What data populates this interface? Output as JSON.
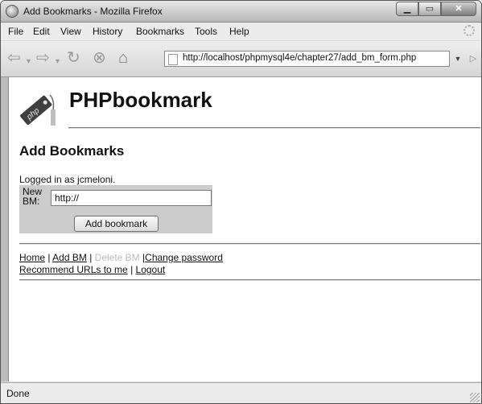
{
  "window": {
    "title": "Add Bookmarks - Mozilla Firefox",
    "minimize_icon": "minimize-icon",
    "maximize_icon": "maximize-icon",
    "close_icon": "close-icon"
  },
  "menu": [
    {
      "label": "File"
    },
    {
      "label": "Edit"
    },
    {
      "label": "View"
    },
    {
      "label": "History"
    },
    {
      "label": "Bookmarks"
    },
    {
      "label": "Tools"
    },
    {
      "label": "Help"
    }
  ],
  "nav": {
    "url": "http://localhost/phpmysql4e/chapter27/add_bm_form.php"
  },
  "page": {
    "app_title": "PHPbookmark",
    "logo_text": "php",
    "heading": "Add Bookmarks",
    "logged_in": "Logged in as jcmeloni.",
    "form": {
      "label": "New BM:",
      "url_value": "http://",
      "button_label": "Add bookmark"
    },
    "links": {
      "home": "Home",
      "add_bm": "Add BM",
      "delete_bm": "Delete BM",
      "change_password": "Change password",
      "recommend": "Recommend URLs to me",
      "logout": "Logout",
      "sep": "|"
    }
  },
  "status": {
    "text": "Done"
  }
}
